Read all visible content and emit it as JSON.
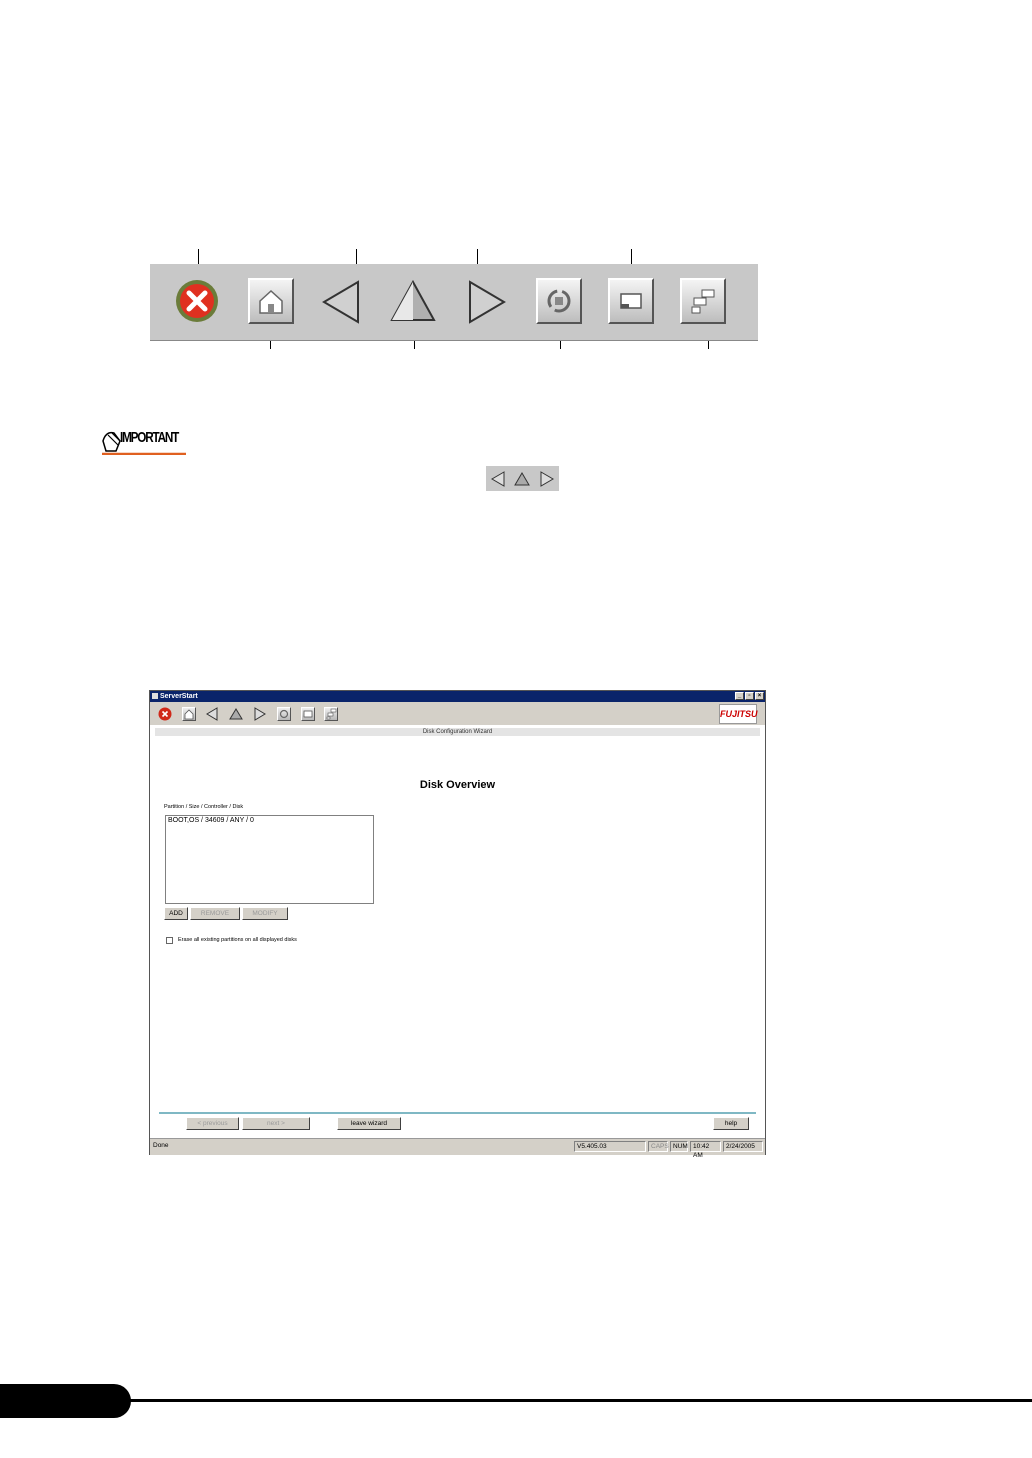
{
  "important_badge": {
    "label": "IMPORTANT"
  },
  "big_toolbar": {
    "buttons": [
      "exit-icon",
      "home-icon",
      "back-icon",
      "up-icon",
      "forward-icon",
      "refresh-icon",
      "window-icon",
      "tree-icon"
    ]
  },
  "window": {
    "title": "ServerStart",
    "controls": [
      "_",
      "▫",
      "×"
    ],
    "logo": "FUJITSU",
    "wizard_bar": "Disk Configuration Wizard",
    "heading": "Disk Overview",
    "list_label": "Partition / Size / Controller / Disk",
    "list_rows": [
      "BOOT,OS / 34609 / ANY / 0"
    ],
    "buttons": {
      "add": "ADD",
      "remove": "REMOVE",
      "modify": "MODIFY"
    },
    "checkbox_label": "Erase all existing partitions on all displayed disks",
    "nav": {
      "previous": "< previous",
      "next": "next >",
      "leave": "leave wizard",
      "help": "help"
    },
    "status": {
      "left": "Done",
      "version": "V5.405.03",
      "caps": "CAPS",
      "num": "NUM",
      "time": "10:42 AM",
      "date": "2/24/2005"
    }
  }
}
